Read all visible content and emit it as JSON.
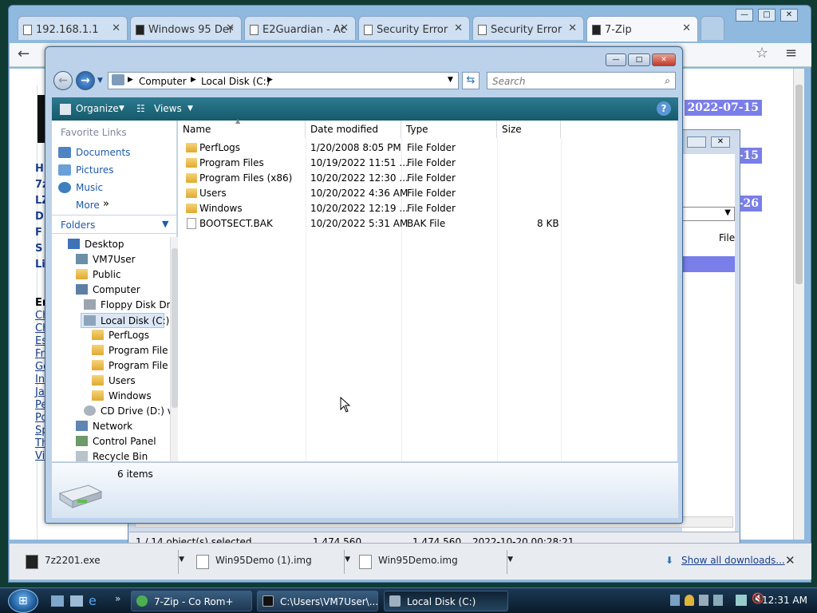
{
  "browser": {
    "tabs": [
      {
        "title": "192.168.1.1"
      },
      {
        "title": "Windows 95 Der"
      },
      {
        "title": "E2Guardian - Ac"
      },
      {
        "title": "Security Error"
      },
      {
        "title": "Security Error"
      },
      {
        "title": "7-Zip"
      }
    ],
    "close_glyph": "✕",
    "downloads": [
      {
        "name": "7z2201.exe"
      },
      {
        "name": "Win95Demo (1).img"
      },
      {
        "name": "Win95Demo.img"
      }
    ],
    "show_all_downloads": "Show all downloads...",
    "dl_close": "✕"
  },
  "web_page": {
    "dates": [
      "2022-07-15",
      "-15",
      "-26"
    ],
    "links": [
      "H",
      "7z",
      "LZ",
      "D",
      "F",
      "S",
      "Li"
    ],
    "section_label": "Er",
    "lang_links": [
      "Ch",
      "Ch",
      "Es",
      "Fr",
      "Ge",
      "In",
      "Ja",
      "Pe",
      "Po",
      "Sp",
      "Th",
      "Vi"
    ]
  },
  "zip_window": {
    "col_file": "File",
    "status": {
      "selected": "1 / 14 object(s) selected",
      "size": "1 474 560",
      "packed": "1 474 560",
      "modified": "2022-10-20 00:28:21"
    }
  },
  "explorer": {
    "breadcrumb": [
      "Computer",
      "Local Disk (C:)"
    ],
    "search_placeholder": "Search",
    "toolbar": {
      "organize": "Organize",
      "views": "Views",
      "help": "?"
    },
    "favorite_links_title": "Favorite Links",
    "favorites": [
      {
        "label": "Documents",
        "icon": "documents-icon"
      },
      {
        "label": "Pictures",
        "icon": "pictures-icon"
      },
      {
        "label": "Music",
        "icon": "music-icon"
      },
      {
        "label": "More",
        "icon": "more-icon"
      }
    ],
    "folders_title": "Folders",
    "tree": [
      {
        "label": "Desktop",
        "indent": 0,
        "icon": "desktop-icon"
      },
      {
        "label": "VM7User",
        "indent": 1,
        "icon": "user-folder-icon"
      },
      {
        "label": "Public",
        "indent": 1,
        "icon": "folder-icon"
      },
      {
        "label": "Computer",
        "indent": 1,
        "icon": "computer-icon"
      },
      {
        "label": "Floppy Disk Dr",
        "indent": 2,
        "icon": "floppy-icon"
      },
      {
        "label": "Local Disk (C:)",
        "indent": 2,
        "icon": "drive-icon",
        "selected": true
      },
      {
        "label": "PerfLogs",
        "indent": 3,
        "icon": "folder-icon"
      },
      {
        "label": "Program File",
        "indent": 3,
        "icon": "folder-icon"
      },
      {
        "label": "Program File",
        "indent": 3,
        "icon": "folder-icon"
      },
      {
        "label": "Users",
        "indent": 3,
        "icon": "folder-icon"
      },
      {
        "label": "Windows",
        "indent": 3,
        "icon": "folder-icon"
      },
      {
        "label": "CD Drive (D:) v",
        "indent": 2,
        "icon": "cd-drive-icon"
      },
      {
        "label": "Network",
        "indent": 1,
        "icon": "network-icon"
      },
      {
        "label": "Control Panel",
        "indent": 1,
        "icon": "control-panel-icon"
      },
      {
        "label": "Recycle Bin",
        "indent": 1,
        "icon": "recycle-bin-icon"
      }
    ],
    "columns": {
      "name": "Name",
      "date": "Date modified",
      "type": "Type",
      "size": "Size"
    },
    "files": [
      {
        "name": "PerfLogs",
        "date": "1/20/2008 8:05 PM",
        "type": "File Folder",
        "size": "",
        "icon": "folder-icon"
      },
      {
        "name": "Program Files",
        "date": "10/19/2022 11:51 ...",
        "type": "File Folder",
        "size": "",
        "icon": "folder-icon"
      },
      {
        "name": "Program Files (x86)",
        "date": "10/20/2022 12:30 ...",
        "type": "File Folder",
        "size": "",
        "icon": "folder-icon"
      },
      {
        "name": "Users",
        "date": "10/20/2022 4:36 AM",
        "type": "File Folder",
        "size": "",
        "icon": "folder-icon"
      },
      {
        "name": "Windows",
        "date": "10/20/2022 12:19 ...",
        "type": "File Folder",
        "size": "",
        "icon": "folder-icon"
      },
      {
        "name": "BOOTSECT.BAK",
        "date": "10/20/2022 5:31 AM",
        "type": "BAK File",
        "size": "8 KB",
        "icon": "file-icon"
      }
    ],
    "item_count": "6 items"
  },
  "taskbar": {
    "items": [
      {
        "label": "7-Zip - Co Rom+"
      },
      {
        "label": "C:\\Users\\VM7User\\..."
      },
      {
        "label": "Local Disk (C:)"
      }
    ],
    "clock": "12:31 AM"
  }
}
